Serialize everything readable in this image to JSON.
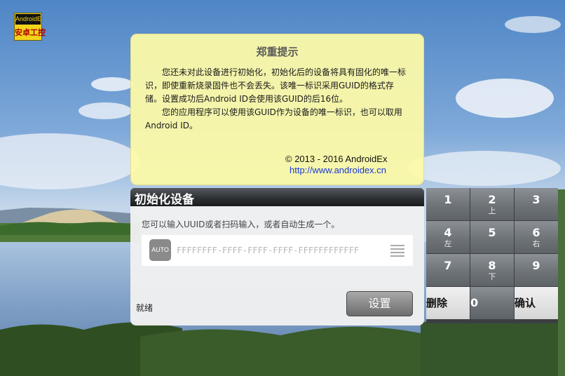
{
  "logo": {
    "line1": "AndroidEx",
    "line2": "安卓工控"
  },
  "notice": {
    "title": "郑重提示",
    "paragraph1": "您还未对此设备进行初始化，初始化后的设备将具有固化的唯一标识，即使重新烧录固件也不会丢失。该唯一标识采用GUID的格式存储。设置成功后Android ID会使用该GUID的后16位。",
    "paragraph2": "您的应用程序可以使用该GUID作为设备的唯一标识，也可以取用Android ID。",
    "copyright": "© 2013 - 2016 AndroidEx",
    "link": "http://www.androidex.cn"
  },
  "init_panel": {
    "title": "初始化设备",
    "hint": "您可以输入UUID或者扫码输入，或者自动生成一个。",
    "auto_label": "AUTO",
    "guid_value": "",
    "guid_placeholder": "FFFFFFFF-FFFF-FFFF-FFFF-FFFFFFFFFFFF",
    "status": "就绪",
    "set_label": "设置"
  },
  "keypad": {
    "keys": [
      {
        "digit": "1",
        "sub": ""
      },
      {
        "digit": "2",
        "sub": "上"
      },
      {
        "digit": "3",
        "sub": ""
      },
      {
        "digit": "4",
        "sub": "左"
      },
      {
        "digit": "5",
        "sub": ""
      },
      {
        "digit": "6",
        "sub": "右"
      },
      {
        "digit": "7",
        "sub": ""
      },
      {
        "digit": "8",
        "sub": "下"
      },
      {
        "digit": "9",
        "sub": ""
      }
    ],
    "delete_label": "删除",
    "zero_label": "0",
    "confirm_label": "确认"
  }
}
